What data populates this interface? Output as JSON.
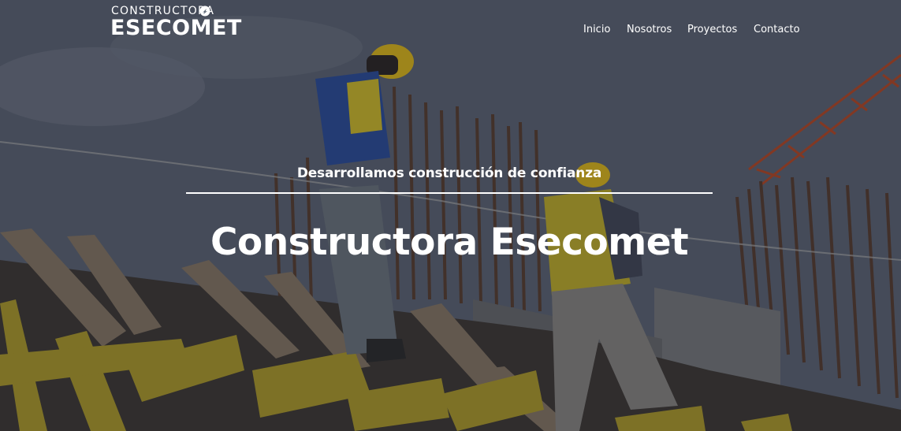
{
  "brand": {
    "top_text": "CONSTRUCTORA",
    "main_text": "ESECOMET"
  },
  "nav": {
    "items": [
      {
        "label": "Inicio"
      },
      {
        "label": "Nosotros"
      },
      {
        "label": "Proyectos"
      },
      {
        "label": "Contacto"
      }
    ]
  },
  "hero": {
    "tagline": "Desarrollamos construcción de confianza",
    "headline": "Constructora Esecomet",
    "background_icon": "construction-workers-photo"
  },
  "colors": {
    "text": "#ffffff",
    "overlay": "#14161f",
    "helmet": "#e8c01a",
    "formwork": "#b9a32a"
  }
}
